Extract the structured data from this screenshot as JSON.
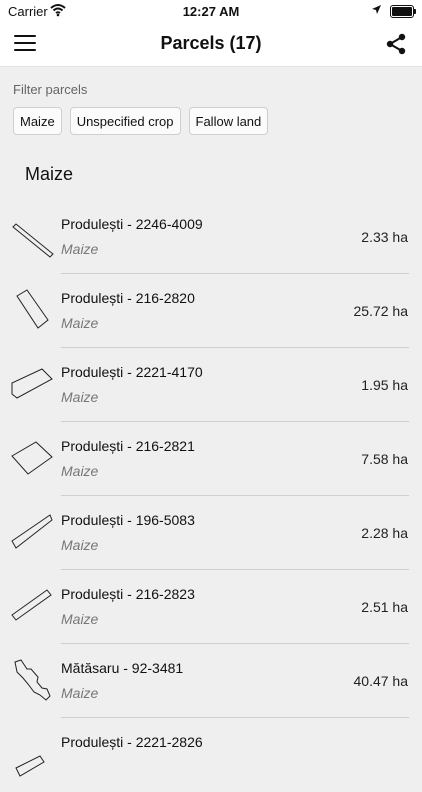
{
  "status_bar": {
    "carrier": "Carrier",
    "time": "12:27 AM"
  },
  "nav": {
    "title": "Parcels (17)"
  },
  "filter": {
    "label": "Filter parcels",
    "chips": [
      "Maize",
      "Unspecified crop",
      "Fallow land"
    ]
  },
  "section": {
    "title": "Maize"
  },
  "parcels": [
    {
      "name": "Produlești - 2246-4009",
      "crop": "Maize",
      "area": "2.33 ha"
    },
    {
      "name": "Produlești - 216-2820",
      "crop": "Maize",
      "area": "25.72 ha"
    },
    {
      "name": "Produlești - 2221-4170",
      "crop": "Maize",
      "area": "1.95 ha"
    },
    {
      "name": "Produlești - 216-2821",
      "crop": "Maize",
      "area": "7.58 ha"
    },
    {
      "name": "Produlești - 196-5083",
      "crop": "Maize",
      "area": "2.28 ha"
    },
    {
      "name": "Produlești - 216-2823",
      "crop": "Maize",
      "area": "2.51 ha"
    },
    {
      "name": "Mătăsaru - 92-3481",
      "crop": "Maize",
      "area": "40.47 ha"
    },
    {
      "name": "Produlești - 2221-2826",
      "crop": "",
      "area": ""
    }
  ],
  "icons": {
    "wifi": "wifi-icon",
    "location": "location-arrow-icon",
    "battery": "battery-icon",
    "menu": "hamburger-menu-icon",
    "share": "share-icon",
    "parcel": "parcel-shape-icon"
  }
}
